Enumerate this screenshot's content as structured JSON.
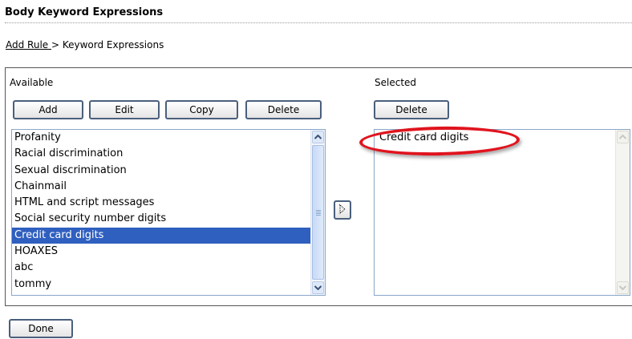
{
  "header": {
    "title": "Body Keyword Expressions"
  },
  "breadcrumb": {
    "link": "Add Rule ",
    "separator": ">",
    "current": " Keyword Expressions"
  },
  "available": {
    "label": "Available",
    "buttons": {
      "add": "Add",
      "edit": "Edit",
      "copy": "Copy",
      "delete": "Delete"
    },
    "items": [
      "Profanity",
      "Racial discrimination",
      "Sexual discrimination",
      "Chainmail",
      "HTML and script messages",
      "Social security number digits",
      "Credit card digits",
      "HOAXES",
      "abc",
      "tommy"
    ],
    "selected_item": "Credit card digits"
  },
  "selected": {
    "label": "Selected",
    "buttons": {
      "delete": "Delete"
    },
    "items": [
      "Credit card digits"
    ]
  },
  "footer": {
    "done": "Done"
  },
  "colors": {
    "highlight_ring": "#e0141e",
    "selection": "#2f5fbf",
    "button_border": "#4a5f7c"
  },
  "icons": {
    "move": "move-right-icon",
    "scroll_up": "chevron-up-icon",
    "scroll_down": "chevron-down-icon"
  }
}
